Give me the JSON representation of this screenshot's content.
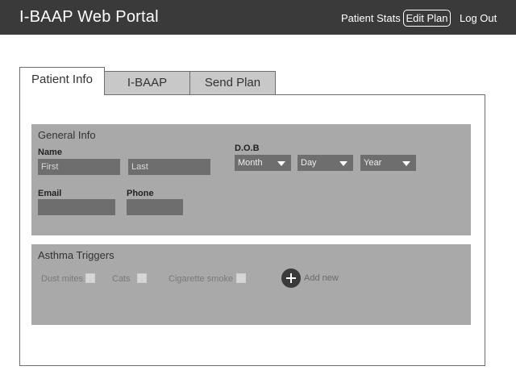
{
  "header": {
    "title": "I-BAAP Web Portal",
    "nav": {
      "patient_stats": "Patient Stats",
      "edit_plan": "Edit Plan",
      "log_out": "Log Out"
    }
  },
  "tabs": [
    {
      "label": "Patient Info",
      "active": true
    },
    {
      "label": "I-BAAP",
      "active": false
    },
    {
      "label": "Send Plan",
      "active": false
    }
  ],
  "general_info": {
    "title": "General Info",
    "name_label": "Name",
    "first_placeholder": "First",
    "last_placeholder": "Last",
    "dob_label": "D.O.B",
    "month": "Month",
    "day": "Day",
    "year": "Year",
    "email_label": "Email",
    "phone_label": "Phone"
  },
  "asthma_triggers": {
    "title": "Asthma Triggers",
    "items": [
      "Dust mites",
      "Cats",
      "Cigarette smoke"
    ],
    "add_new": "Add new"
  },
  "colors": {
    "topbar": "#3a3a3a",
    "section_bg": "#a9a9a9",
    "input_bg": "#6e6e6e",
    "tab_inactive": "#c8c8c8"
  }
}
